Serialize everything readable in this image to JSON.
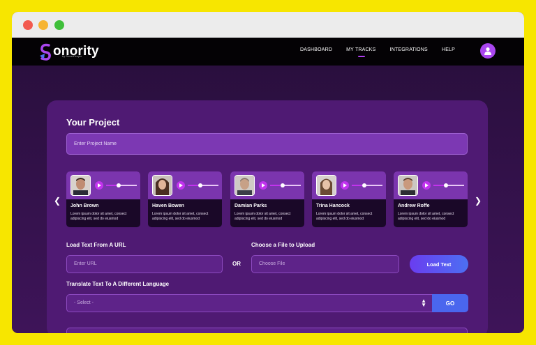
{
  "app": {
    "logo_text": "onority",
    "logo_sub": "by SmartPeople"
  },
  "nav": {
    "links": [
      {
        "label": "DASHBOARD"
      },
      {
        "label": "MY TRACKS"
      },
      {
        "label": "INTEGRATIONS"
      },
      {
        "label": "HELP"
      }
    ],
    "active": "MY TRACKS"
  },
  "project": {
    "title": "Your Project",
    "placeholder": "Enter Project Name"
  },
  "voices": [
    {
      "name": "John Brown",
      "description": "Lorem ipsum dolor sit amet, consect adipiscing elit, sed do eiusmod",
      "progress": 0.4
    },
    {
      "name": "Haven Bowen",
      "description": "Lorem ipsum dolor sit amet, consect adipiscing elit, sed do eiusmod",
      "progress": 0.4
    },
    {
      "name": "Damian Parks",
      "description": "Lorem ipsum dolor sit amet, consect adipiscing elit, sed do eiusmod",
      "progress": 0.4
    },
    {
      "name": "Trina Hancock",
      "description": "Lorem ipsum dolor sit amet, consect adipiscing elit, sed do eiusmod",
      "progress": 0.4
    },
    {
      "name": "Andrew Roffe",
      "description": "Lorem ipsum dolor sit amet, consect adipiscing elit, sed do eiusmod",
      "progress": 0.4
    }
  ],
  "load_url": {
    "label": "Load Text From A URL",
    "placeholder": "Enter URL"
  },
  "or_label": "OR",
  "upload": {
    "label": "Choose a File to Upload",
    "placeholder": "Choose File",
    "button": "Load Text"
  },
  "translate": {
    "label": "Translate Text To A Different Language",
    "selected": "- Select -",
    "button": "GO"
  },
  "colors": {
    "accent": "#b03ff0",
    "button_blue": "#4a66ee",
    "card": "#4f1a73"
  }
}
